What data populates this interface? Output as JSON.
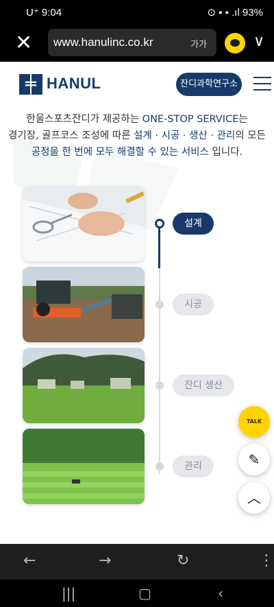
{
  "status": {
    "time": "U⁺ 9:04",
    "indicators": "⊙ ▪ ▪ .ıl 93%"
  },
  "browser": {
    "url": "www.hanulinc.co.kr",
    "tab_label": "가가"
  },
  "site": {
    "logo_text": "HANUL",
    "lab_button": "잔디과학연구소"
  },
  "intro": {
    "line1_a": "한울스포츠잔디가 제공하는 ",
    "line1_b": "ONE-STOP SERVICE",
    "line1_c": "는",
    "line2_a": "경기장, 골프코스 조성에 따른 ",
    "line2_b": "설계 · 시공 · 생산 · 관리",
    "line2_c": "의 모든",
    "line3_a": "공정을 한 번에 모두 해결할 수 있는 ",
    "line3_b": "서비스",
    "line3_c": " 입니다."
  },
  "steps": [
    {
      "label": "설계",
      "active": true
    },
    {
      "label": "시공",
      "active": false
    },
    {
      "label": "잔디 생산",
      "active": false
    },
    {
      "label": "관리",
      "active": false
    }
  ],
  "fabs": {
    "talk_label": "TALK"
  },
  "colors": {
    "brand": "#173a6b",
    "kakao": "#ffd400"
  }
}
